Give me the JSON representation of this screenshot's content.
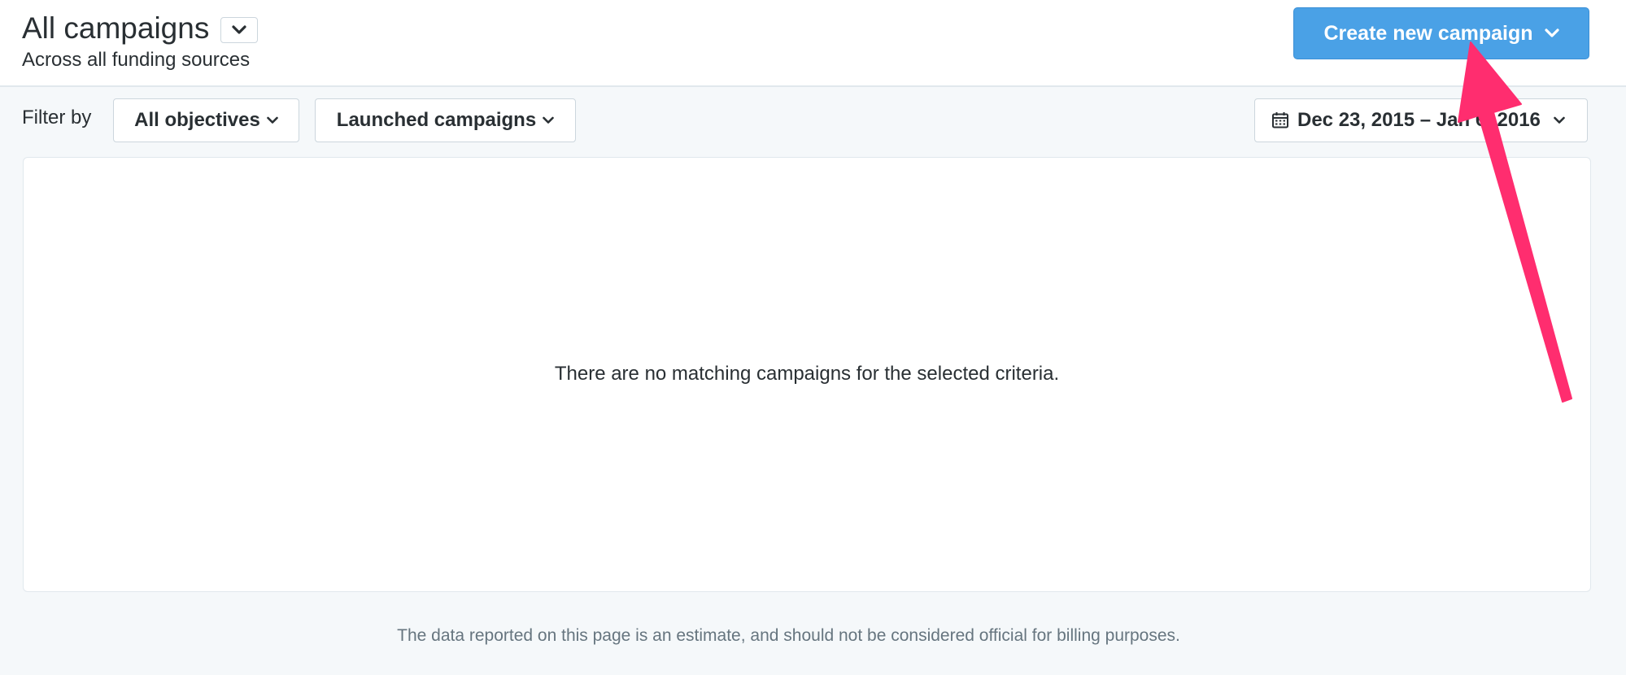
{
  "header": {
    "title": "All campaigns",
    "subtitle": "Across all funding sources",
    "create_button_label": "Create new campaign"
  },
  "filters": {
    "label": "Filter by",
    "objectives_label": "All objectives",
    "status_label": "Launched campaigns",
    "date_range_label": "Dec 23, 2015 – Jan 6, 2016"
  },
  "content": {
    "empty_message": "There are no matching campaigns for the selected criteria."
  },
  "footer": {
    "note": "The data reported on this page is an estimate, and should not be considered official for billing purposes."
  },
  "colors": {
    "primary_button": "#4aa1e6",
    "annotation_arrow": "#ff2d6f",
    "page_background": "#f5f8fa"
  },
  "icons": [
    "chevron-down-icon",
    "calendar-icon",
    "annotation-arrow"
  ]
}
